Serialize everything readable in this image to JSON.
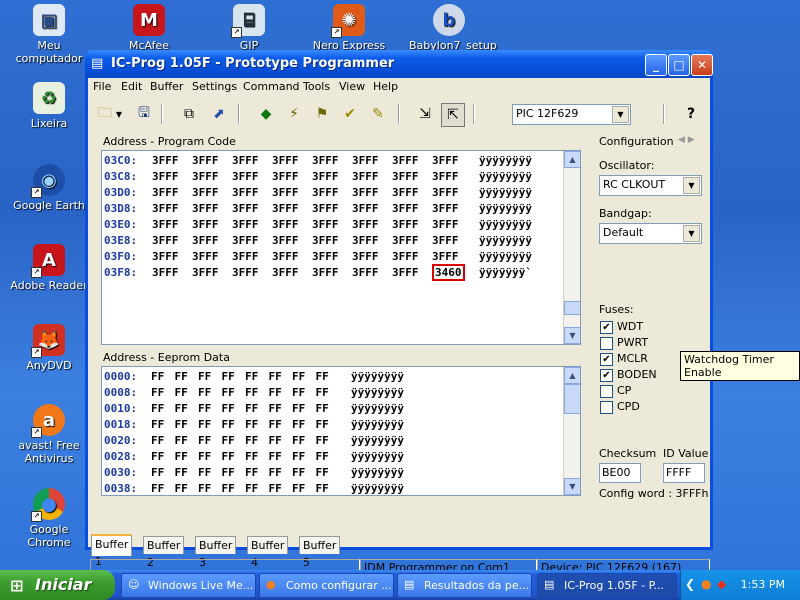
{
  "desktop": {
    "icons": [
      {
        "label": "Meu computador"
      },
      {
        "label": "McAfee Security"
      },
      {
        "label": "GIP"
      },
      {
        "label": "Nero Express"
      },
      {
        "label": "Babylon7_setup"
      },
      {
        "label": "Lixeira"
      },
      {
        "label": "Google Earth"
      },
      {
        "label": "Adobe Reader"
      },
      {
        "label": "AnyDVD"
      },
      {
        "label": "avast! Free Antivirus"
      },
      {
        "label": "Google Chrome"
      }
    ]
  },
  "window": {
    "title": "IC-Prog 1.05F - Prototype Programmer",
    "menu": [
      "File",
      "Edit",
      "Buffer",
      "Settings",
      "Command",
      "Tools",
      "View",
      "Help"
    ],
    "device_select": "PIC 12F629"
  },
  "program_code": {
    "label": "Address - Program Code",
    "rows": [
      {
        "addr": "03C0:",
        "cells": [
          "3FFF",
          "3FFF",
          "3FFF",
          "3FFF",
          "3FFF",
          "3FFF",
          "3FFF",
          "3FFF"
        ],
        "ascii": "ÿÿÿÿÿÿÿÿ"
      },
      {
        "addr": "03C8:",
        "cells": [
          "3FFF",
          "3FFF",
          "3FFF",
          "3FFF",
          "3FFF",
          "3FFF",
          "3FFF",
          "3FFF"
        ],
        "ascii": "ÿÿÿÿÿÿÿÿ"
      },
      {
        "addr": "03D0:",
        "cells": [
          "3FFF",
          "3FFF",
          "3FFF",
          "3FFF",
          "3FFF",
          "3FFF",
          "3FFF",
          "3FFF"
        ],
        "ascii": "ÿÿÿÿÿÿÿÿ"
      },
      {
        "addr": "03D8:",
        "cells": [
          "3FFF",
          "3FFF",
          "3FFF",
          "3FFF",
          "3FFF",
          "3FFF",
          "3FFF",
          "3FFF"
        ],
        "ascii": "ÿÿÿÿÿÿÿÿ"
      },
      {
        "addr": "03E0:",
        "cells": [
          "3FFF",
          "3FFF",
          "3FFF",
          "3FFF",
          "3FFF",
          "3FFF",
          "3FFF",
          "3FFF"
        ],
        "ascii": "ÿÿÿÿÿÿÿÿ"
      },
      {
        "addr": "03E8:",
        "cells": [
          "3FFF",
          "3FFF",
          "3FFF",
          "3FFF",
          "3FFF",
          "3FFF",
          "3FFF",
          "3FFF"
        ],
        "ascii": "ÿÿÿÿÿÿÿÿ"
      },
      {
        "addr": "03F0:",
        "cells": [
          "3FFF",
          "3FFF",
          "3FFF",
          "3FFF",
          "3FFF",
          "3FFF",
          "3FFF",
          "3FFF"
        ],
        "ascii": "ÿÿÿÿÿÿÿÿ"
      },
      {
        "addr": "03F8:",
        "cells": [
          "3FFF",
          "3FFF",
          "3FFF",
          "3FFF",
          "3FFF",
          "3FFF",
          "3FFF",
          "3460"
        ],
        "ascii": "ÿÿÿÿÿÿÿ`"
      }
    ]
  },
  "eeprom": {
    "label": "Address - Eeprom Data",
    "rows": [
      {
        "addr": "0000:",
        "cells": [
          "FF",
          "FF",
          "FF",
          "FF",
          "FF",
          "FF",
          "FF",
          "FF"
        ],
        "ascii": "ÿÿÿÿÿÿÿÿ"
      },
      {
        "addr": "0008:",
        "cells": [
          "FF",
          "FF",
          "FF",
          "FF",
          "FF",
          "FF",
          "FF",
          "FF"
        ],
        "ascii": "ÿÿÿÿÿÿÿÿ"
      },
      {
        "addr": "0010:",
        "cells": [
          "FF",
          "FF",
          "FF",
          "FF",
          "FF",
          "FF",
          "FF",
          "FF"
        ],
        "ascii": "ÿÿÿÿÿÿÿÿ"
      },
      {
        "addr": "0018:",
        "cells": [
          "FF",
          "FF",
          "FF",
          "FF",
          "FF",
          "FF",
          "FF",
          "FF"
        ],
        "ascii": "ÿÿÿÿÿÿÿÿ"
      },
      {
        "addr": "0020:",
        "cells": [
          "FF",
          "FF",
          "FF",
          "FF",
          "FF",
          "FF",
          "FF",
          "FF"
        ],
        "ascii": "ÿÿÿÿÿÿÿÿ"
      },
      {
        "addr": "0028:",
        "cells": [
          "FF",
          "FF",
          "FF",
          "FF",
          "FF",
          "FF",
          "FF",
          "FF"
        ],
        "ascii": "ÿÿÿÿÿÿÿÿ"
      },
      {
        "addr": "0030:",
        "cells": [
          "FF",
          "FF",
          "FF",
          "FF",
          "FF",
          "FF",
          "FF",
          "FF"
        ],
        "ascii": "ÿÿÿÿÿÿÿÿ"
      },
      {
        "addr": "0038:",
        "cells": [
          "FF",
          "FF",
          "FF",
          "FF",
          "FF",
          "FF",
          "FF",
          "FF"
        ],
        "ascii": "ÿÿÿÿÿÿÿÿ"
      }
    ]
  },
  "config": {
    "title": "Configuration",
    "oscillator_label": "Oscillator:",
    "oscillator_value": "RC CLKOUT",
    "bandgap_label": "Bandgap:",
    "bandgap_value": "Default",
    "fuses_label": "Fuses:",
    "fuses": [
      {
        "name": "WDT",
        "checked": true
      },
      {
        "name": "PWRT",
        "checked": false
      },
      {
        "name": "MCLR",
        "checked": true
      },
      {
        "name": "BODEN",
        "checked": true
      },
      {
        "name": "CP",
        "checked": false
      },
      {
        "name": "CPD",
        "checked": false
      }
    ],
    "checksum_label": "Checksum",
    "checksum_value": "BE00",
    "id_label": "ID Value",
    "id_value": "FFFF",
    "config_word": "Config word : 3FFFh"
  },
  "tooltip": "Watchdog Timer Enable",
  "tabs": [
    "Buffer 1",
    "Buffer 2",
    "Buffer 3",
    "Buffer 4",
    "Buffer 5"
  ],
  "status": {
    "programmer": "JDM Programmer on Com1",
    "device": "Device: PIC 12F629  (167)"
  },
  "taskbar": {
    "start_label": "Iniciar",
    "tasks": [
      {
        "label": "Windows Live Me..."
      },
      {
        "label": "Como configurar ..."
      },
      {
        "label": "Resultados da pe..."
      },
      {
        "label": "IC-Prog 1.05F - P..."
      }
    ],
    "clock": "1:53 PM"
  }
}
